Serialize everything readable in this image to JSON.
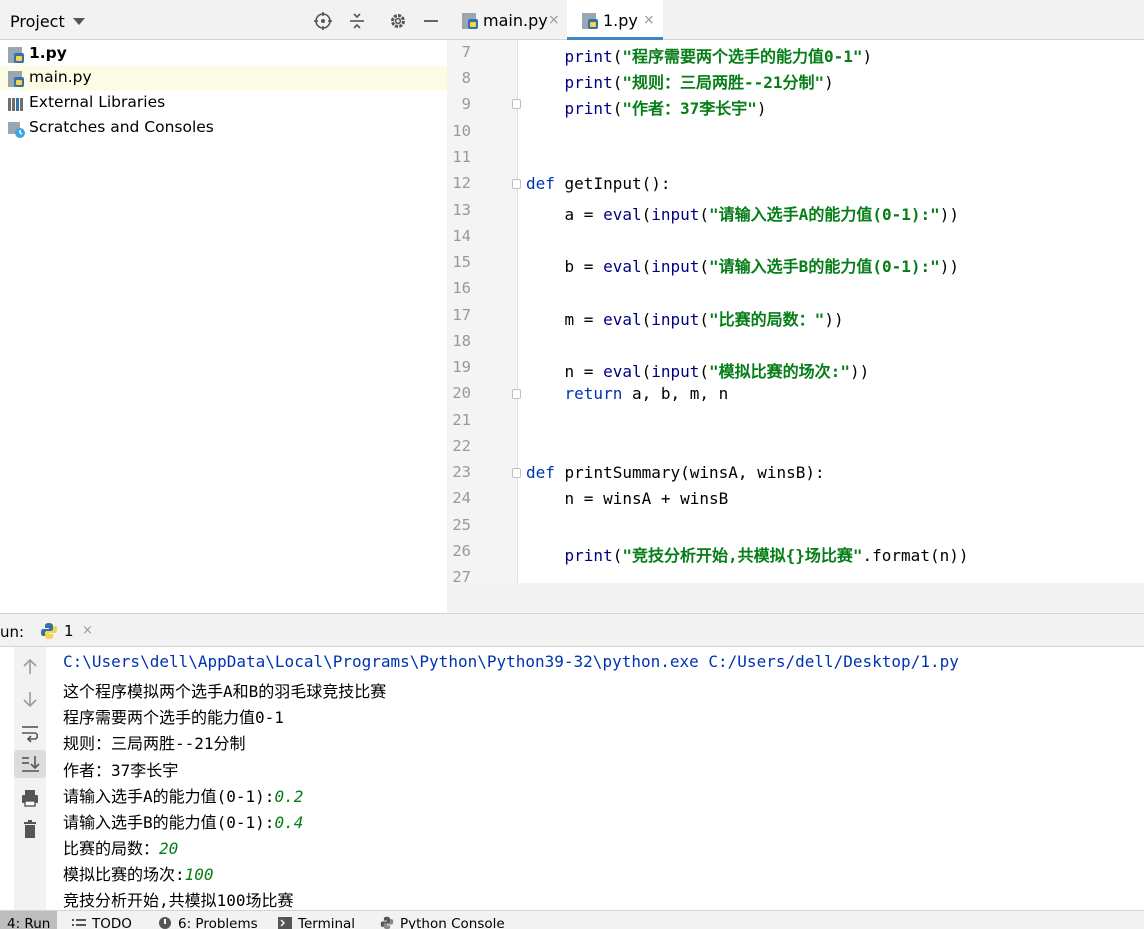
{
  "project_panel": {
    "title": "Project",
    "items": [
      {
        "label": "1.py",
        "bold": true
      },
      {
        "label": "main.py"
      },
      {
        "label": "External Libraries"
      },
      {
        "label": "Scratches and Consoles"
      }
    ]
  },
  "editor": {
    "tabs": [
      {
        "label": "main.py",
        "active": false
      },
      {
        "label": "1.py",
        "active": true
      }
    ],
    "close_glyph": "×",
    "line_numbers": [
      "7",
      "8",
      "9",
      "10",
      "11",
      "12",
      "13",
      "14",
      "15",
      "16",
      "17",
      "18",
      "19",
      "20",
      "21",
      "22",
      "23",
      "24",
      "25",
      "26",
      "27"
    ]
  },
  "code": {
    "l7": {
      "fn": "print",
      "open": "(",
      "str": "\"程序需要两个选手的能力值0-1\"",
      "close": ")"
    },
    "l8": {
      "fn": "print",
      "open": "(",
      "str": "\"规则：三局两胜--21分制\"",
      "close": ")"
    },
    "l9": {
      "fn": "print",
      "open": "(",
      "str": "\"作者：37李长宇\"",
      "close": ")"
    },
    "l12": {
      "kw": "def",
      "rest": " getInput():"
    },
    "l13": {
      "var": "a = ",
      "fn1": "eval",
      "p1": "(",
      "fn2": "input",
      "p2": "(",
      "str": "\"请输入选手A的能力值(0-1):\"",
      "close": "))"
    },
    "l15": {
      "var": "b = ",
      "fn1": "eval",
      "p1": "(",
      "fn2": "input",
      "p2": "(",
      "str": "\"请输入选手B的能力值(0-1):\"",
      "close": "))"
    },
    "l17": {
      "var": "m = ",
      "fn1": "eval",
      "p1": "(",
      "fn2": "input",
      "p2": "(",
      "str": "\"比赛的局数：\"",
      "close": "))"
    },
    "l19": {
      "var": "n = ",
      "fn1": "eval",
      "p1": "(",
      "fn2": "input",
      "p2": "(",
      "str": "\"模拟比赛的场次:\"",
      "close": "))"
    },
    "l20": {
      "kw": "return",
      "rest": " a, b, m, n"
    },
    "l23": {
      "kw": "def",
      "rest": " printSummary(winsA, winsB):"
    },
    "l24": {
      "text": "n = winsA + winsB"
    },
    "l26": {
      "fn": "print",
      "open": "(",
      "str": "\"竞技分析开始,共模拟{}场比赛\"",
      "close": ".format(n))"
    }
  },
  "run_panel": {
    "label": "un:",
    "tab_label": "1",
    "close_glyph": "×",
    "toolbar_icons": [
      "arrow-up-icon",
      "arrow-down-icon",
      "soft-wrap-icon",
      "scroll-to-end-icon",
      "print-icon",
      "trash-icon"
    ],
    "console": {
      "command": "C:\\Users\\dell\\AppData\\Local\\Programs\\Python\\Python39-32\\python.exe C:/Users/dell/Desktop/1.py",
      "line1": "这个程序模拟两个选手A和B的羽毛球竞技比赛",
      "line2": "程序需要两个选手的能力值0-1",
      "line3": "规则：三局两胜--21分制",
      "line4": "作者：37李长宇",
      "prompt_a": "请输入选手A的能力值(0-1):",
      "input_a": "0.2",
      "prompt_b": "请输入选手B的能力值(0-1):",
      "input_b": "0.4",
      "prompt_m": "比赛的局数：",
      "input_m": "20",
      "prompt_n": "模拟比赛的场次:",
      "input_n": "100",
      "line_last": "竞技分析开始,共模拟100场比赛"
    }
  },
  "bottom_bar": {
    "run": "4: Run",
    "todo": "TODO",
    "problems": "6: Problems",
    "terminal": "Terminal",
    "python_console": "Python Console"
  },
  "colors": {
    "keyword": "#0033b3",
    "string": "#067d17",
    "builtin": "#000080",
    "accent": "#4083c9"
  }
}
